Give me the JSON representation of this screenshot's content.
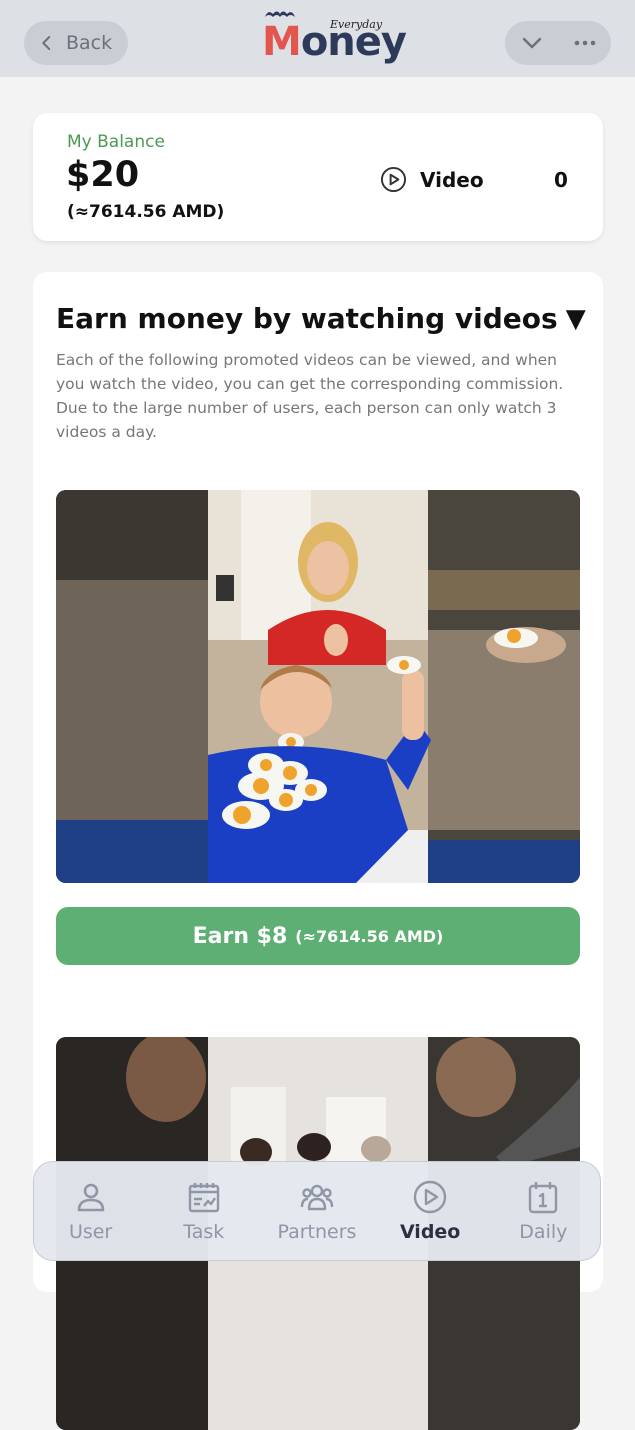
{
  "header": {
    "back_label": "Back",
    "logo_script": "Everyday",
    "logo_m": "M",
    "logo_rest": "oney"
  },
  "balance": {
    "label": "My Balance",
    "amount": "$20",
    "amd": "(≈7614.56 AMD)",
    "video_label": "Video",
    "video_count": "0"
  },
  "section": {
    "title": "Earn money by watching videos",
    "title_marker": "▼",
    "description": "Each of the following promoted videos can be viewed, and when you watch the video, you can get the corresponding commission. Due to the large number of users, each person can only watch 3 videos a day."
  },
  "videos": [
    {
      "earn_label": "Earn $8",
      "earn_amd": "(≈7614.56 AMD)"
    }
  ],
  "nav": {
    "items": [
      {
        "label": "User",
        "icon": "user-icon"
      },
      {
        "label": "Task",
        "icon": "task-icon"
      },
      {
        "label": "Partners",
        "icon": "partners-icon"
      },
      {
        "label": "Video",
        "icon": "video-icon"
      },
      {
        "label": "Daily",
        "icon": "daily-icon"
      }
    ],
    "active": "Video"
  },
  "colors": {
    "accent_green": "#5daf73",
    "balance_label_green": "#4a9a52",
    "logo_red": "#e2564e",
    "logo_navy": "#2e3a5a",
    "nav_inactive": "#8f96a6",
    "nav_active": "#2b3140"
  }
}
